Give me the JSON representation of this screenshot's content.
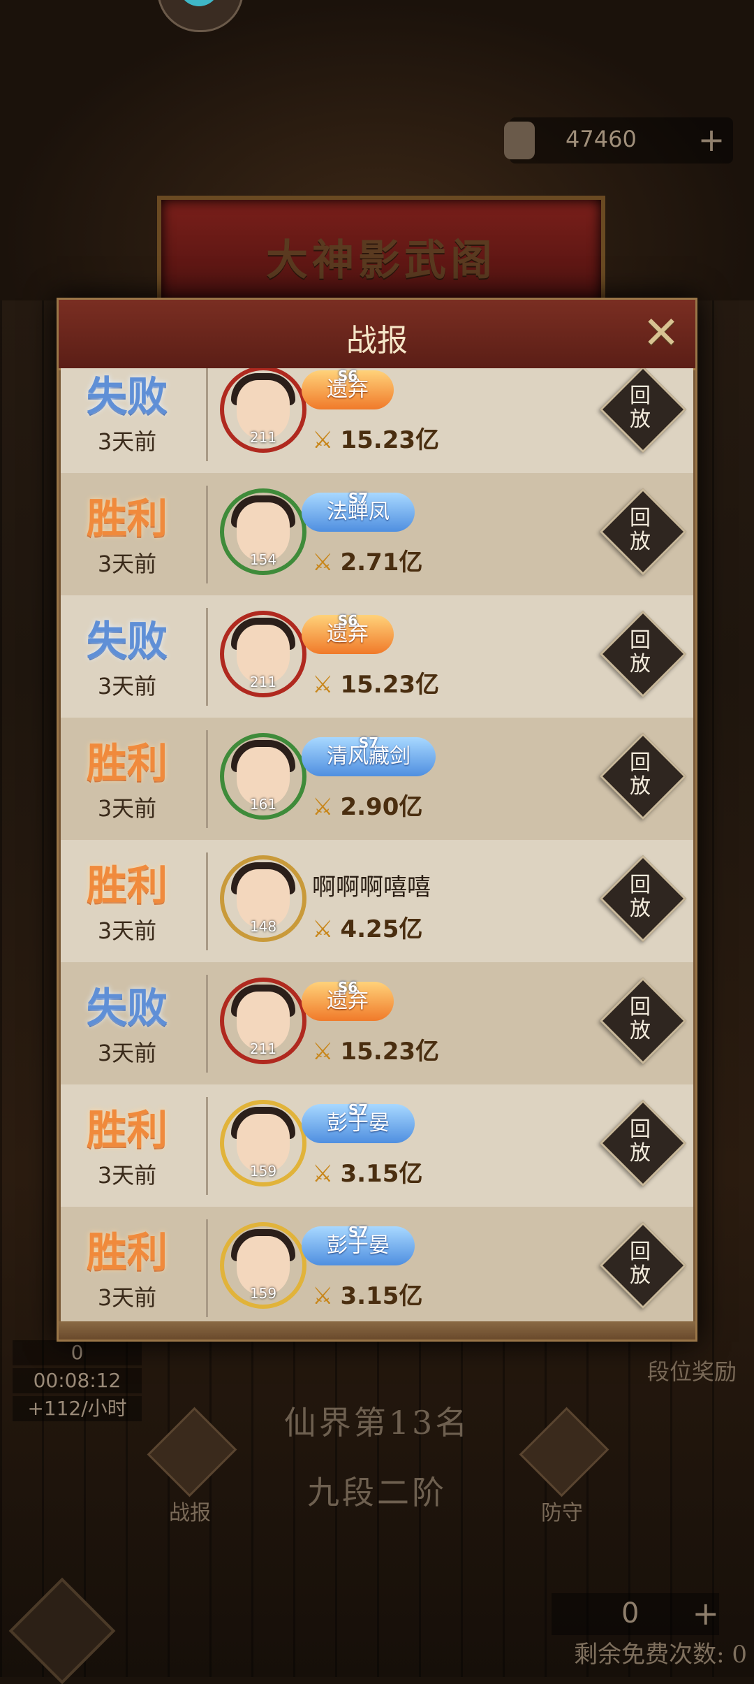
{
  "header": {
    "hall_title": "大神影武阁",
    "currency_value": "47460",
    "currency_plus": "+"
  },
  "modal": {
    "title": "战报",
    "close": "✕"
  },
  "battle_rows": [
    {
      "result": "失败",
      "result_type": "lose",
      "time": "3天前",
      "level": "211",
      "name": "遗弃",
      "season": "S6",
      "tag": "orange",
      "power": "15.23亿",
      "frame": "red"
    },
    {
      "result": "胜利",
      "result_type": "win",
      "time": "3天前",
      "level": "154",
      "name": "法蝉凤",
      "season": "S7",
      "tag": "blue",
      "power": "2.71亿",
      "frame": "green"
    },
    {
      "result": "失败",
      "result_type": "lose",
      "time": "3天前",
      "level": "211",
      "name": "遗弃",
      "season": "S6",
      "tag": "orange",
      "power": "15.23亿",
      "frame": "red"
    },
    {
      "result": "胜利",
      "result_type": "win",
      "time": "3天前",
      "level": "161",
      "name": "清风藏剑",
      "season": "S7",
      "tag": "blue",
      "power": "2.90亿",
      "frame": "green"
    },
    {
      "result": "胜利",
      "result_type": "win",
      "time": "3天前",
      "level": "148",
      "name": "啊啊啊嘻嘻",
      "season": "",
      "tag": "none",
      "power": "4.25亿",
      "frame": "plain"
    },
    {
      "result": "失败",
      "result_type": "lose",
      "time": "3天前",
      "level": "211",
      "name": "遗弃",
      "season": "S6",
      "tag": "orange",
      "power": "15.23亿",
      "frame": "red"
    },
    {
      "result": "胜利",
      "result_type": "win",
      "time": "3天前",
      "level": "159",
      "name": "彭于晏",
      "season": "S7",
      "tag": "blue",
      "power": "3.15亿",
      "frame": "gold"
    },
    {
      "result": "胜利",
      "result_type": "win",
      "time": "3天前",
      "level": "159",
      "name": "彭于晏",
      "season": "S7",
      "tag": "blue",
      "power": "3.15亿",
      "frame": "gold"
    }
  ],
  "replay_label_top": "回",
  "replay_label_bottom": "放",
  "power_icon": "⚔",
  "lower": {
    "count": "0",
    "timer": "00:08:12",
    "rate": "+112/小时",
    "rank": "仙界第13名",
    "tier": "九段二阶",
    "battle_report_label": "战报",
    "defense_label": "防守",
    "rank_reward_label": "段位奖励",
    "free_count": "0",
    "free_plus": "+",
    "free_label": "剩余免费次数: 0"
  }
}
